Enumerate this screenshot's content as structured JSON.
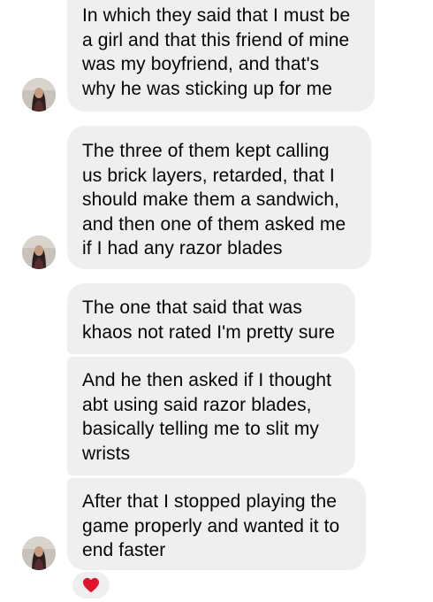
{
  "messages": [
    {
      "text": "In which they said that I must be\na girl and that this friend of mine\nwas my boyfriend, and that's\nwhy he was sticking up for me"
    },
    {
      "text": "The three of them kept calling\nus brick layers, retarded, that I\nshould make them a sandwich,\nand then one of them asked me\nif I had any razor blades"
    },
    {
      "text": "The one that said that was\nkhaos not rated I'm pretty sure"
    },
    {
      "text": "And he then asked if I thought\nabt using said razor blades,\nbasically telling me to slit my\nwrists"
    },
    {
      "text": "After that I stopped playing the\ngame properly and wanted it to\nend faster"
    }
  ],
  "reaction": {
    "emoji": "❤️",
    "color": "#e0142c"
  },
  "colors": {
    "bubble": "#efefef",
    "text": "#050505",
    "background": "#ffffff"
  }
}
